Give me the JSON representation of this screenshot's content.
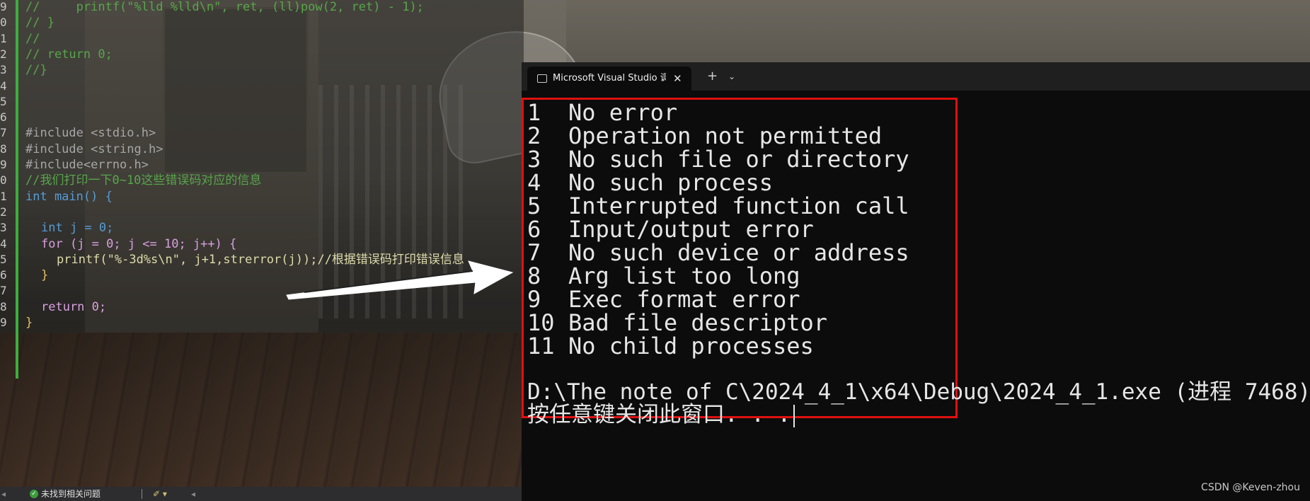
{
  "editor": {
    "lines": [
      {
        "n": "9",
        "code": "//     printf(\"%lld %lld\\n\", ret, (ll)pow(2, ret) - 1);"
      },
      {
        "n": "0",
        "code": "// }"
      },
      {
        "n": "1",
        "code": "//"
      },
      {
        "n": "2",
        "code": "// return 0;"
      },
      {
        "n": "3",
        "code": "//}"
      },
      {
        "n": "4",
        "code": ""
      },
      {
        "n": "5",
        "code": ""
      },
      {
        "n": "6",
        "code": ""
      },
      {
        "n": "7",
        "code": "#include <stdio.h>"
      },
      {
        "n": "8",
        "code": "#include <string.h>"
      },
      {
        "n": "9",
        "code": "#include<errno.h>"
      },
      {
        "n": "0",
        "code": "//我们打印一下0~10这些错误码对应的信息"
      },
      {
        "n": "1",
        "code": "int main() {"
      },
      {
        "n": "2",
        "code": ""
      },
      {
        "n": "3",
        "code": "int j = 0;"
      },
      {
        "n": "4",
        "code": "for (j = 0; j <= 10; j++) {"
      },
      {
        "n": "5",
        "code": "printf(\"%-3d%s\\n\", j+1,strerror(j));//根据错误码打印错误信息"
      },
      {
        "n": "6",
        "code": "}"
      },
      {
        "n": "7",
        "code": ""
      },
      {
        "n": "8",
        "code": "return 0;"
      },
      {
        "n": "9",
        "code": "}"
      }
    ]
  },
  "status_bar": {
    "issues_text": "未找到相关问题",
    "ok_symbol": "✓",
    "brush_symbol": "✐ ▾",
    "left_arrow": "◂",
    "scroll_left": "◂"
  },
  "terminal": {
    "tab_title": "Microsoft Visual Studio 调试控制台",
    "close_symbol": "✕",
    "new_tab_symbol": "+",
    "dropdown_symbol": "⌄",
    "output": [
      {
        "num": "1",
        "msg": "No error"
      },
      {
        "num": "2",
        "msg": "Operation not permitted"
      },
      {
        "num": "3",
        "msg": "No such file or directory"
      },
      {
        "num": "4",
        "msg": "No such process"
      },
      {
        "num": "5",
        "msg": "Interrupted function call"
      },
      {
        "num": "6",
        "msg": "Input/output error"
      },
      {
        "num": "7",
        "msg": "No such device or address"
      },
      {
        "num": "8",
        "msg": "Arg list too long"
      },
      {
        "num": "9",
        "msg": "Exec format error"
      },
      {
        "num": "10",
        "msg": "Bad file descriptor"
      },
      {
        "num": "11",
        "msg": "No child processes"
      }
    ],
    "exit_line": "D:\\The note of C\\2024_4_1\\x64\\Debug\\2024_4_1.exe (进程 7468)",
    "press_key_line": "按任意键关闭此窗口. . ."
  },
  "watermark": "CSDN @Keven-zhou",
  "colors": {
    "highlight_box": "#e01010",
    "terminal_bg": "#0c0c0c",
    "comment": "#57a64a",
    "keyword": "#569cd6"
  }
}
